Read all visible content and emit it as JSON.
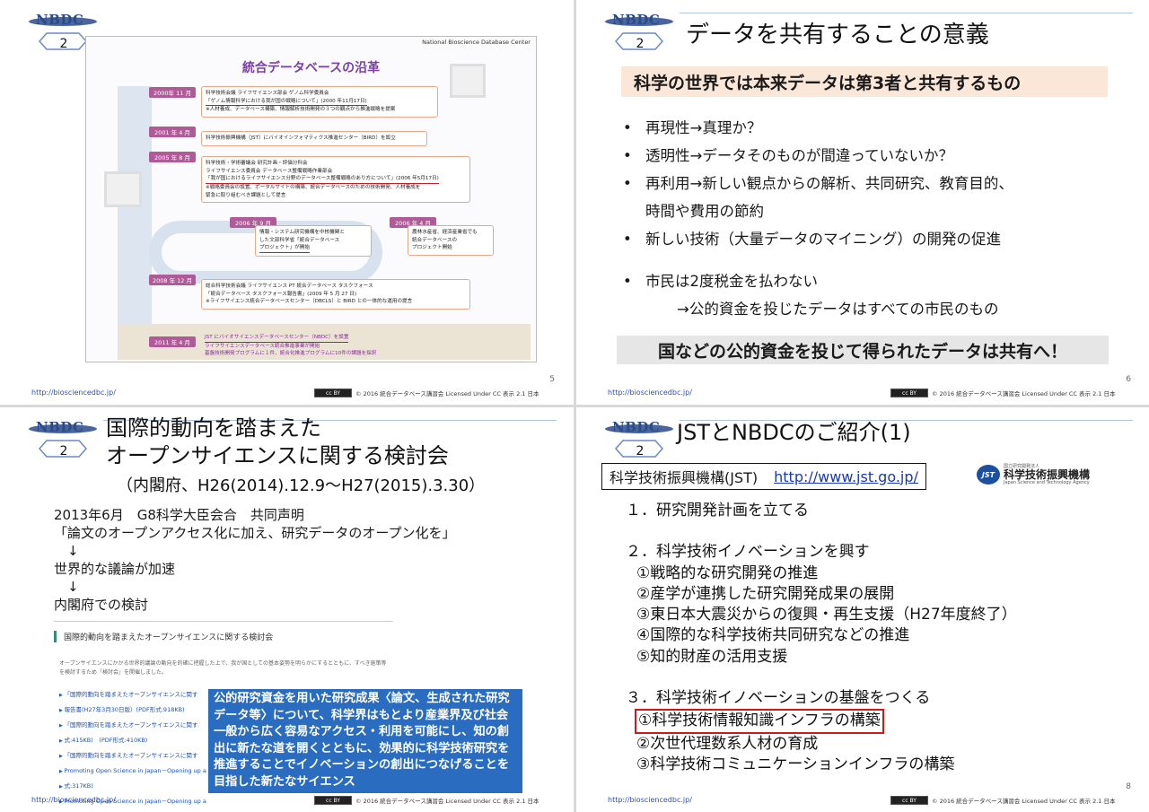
{
  "common": {
    "logo": "NBDC",
    "url": "http://biosciencedbc.jp/",
    "cc_badge": "cc BY",
    "cc_text": "© 2016 統合データベース講習会 Licensed Under CC 表示 2.1 日本"
  },
  "slide1": {
    "logo_num": "2",
    "page": "5",
    "header": "National Bioscience Database Center",
    "title": "統合データベースの沿革",
    "timeline": [
      {
        "date": "2000年 11 月",
        "lines": [
          "科学技術会議 ライフサイエンス部会 ゲノム科学委員会",
          "「ゲノム情報科学における我が国の戦略について」(2000 年11月17日)",
          "※人材養成、データベース構築、情報解析技術開発の３つの観点から推進戦略を提案"
        ]
      },
      {
        "date": "2001 年 4 月",
        "lines": [
          "科学技術振興機構（JST）にバイオインフォマティクス推進センター（BIRD）を設立"
        ]
      },
      {
        "date": "2005 年 8 月",
        "lines": [
          "科学技術・学術審議会 研究計画・評価分科会",
          "ライフサイエンス委員会 データベース整備戦略作業部会",
          "「我が国におけるライフサイエンス分野のデータベース整備戦略のあり方について」(2006 年5月17日)",
          "※戦略委員会の設置、ポータルサイトの構築、統合データベースのための技術開発、人材養成を",
          "緊急に取り組むべき課題として提言"
        ]
      },
      {
        "date": "2006 年 9 月",
        "lines": [
          "情報・システム研究機構を中核機関と",
          "した文部科学省「統合データベース",
          "プロジェクト」が開始"
        ]
      },
      {
        "date": "2006 年 4 月",
        "lines": [
          "農林水産省、経済産業省でも",
          "統合データベースの",
          "プロジェクト開始"
        ]
      },
      {
        "date": "2008 年 12 月",
        "lines": [
          "総合科学技術会議 ライフサイエンス PT 統合データベース タスクフォース",
          "「統合データベース タスクフォース報告書」(2009 年 5 月 27 日)",
          "※ライフサイエンス統合データベースセンター（DBCLS）と BIRD との一体的な運用の提言"
        ]
      },
      {
        "date": "2011 年 4 月",
        "lines": [
          "JST にバイオサイエンスデータベースセンター（NBDC）を設置",
          "ライフサイエンスデータベース統合推進事業が開始",
          "基盤技術開発プログラムに１件、統合化推進プログラムに10件の課題を採択"
        ]
      }
    ]
  },
  "slide2": {
    "logo_num": "2",
    "page": "6",
    "title": "データを共有することの意義",
    "highlight": "科学の世界では本来データは第3者と共有するもの",
    "bullets": [
      "再現性→真理か？",
      "透明性→データそのものが間違っていないか？",
      "再利用→新しい観点からの解析、共同研究、教育目的、",
      "新しい技術（大量データのマイニング）の開発の促進",
      "市民は2度税金を払わない"
    ],
    "cont": "時間や費用の節約",
    "indent": "→公的資金を投じたデータはすべての市民のもの",
    "footer": "国などの公的資金を投じて得られたデータは共有へ！"
  },
  "slide3": {
    "logo_num": "2",
    "title_line1": "国際的動向を踏まえた",
    "title_line2": "オープンサイエンスに関する検討会",
    "subtitle": "（内閣府、H26(2014).12.9〜H27(2015).3.30）",
    "body": [
      "2013年6月　G8科学大臣会合　共同声明",
      "「論文のオープンアクセス化に加え、研究データのオープン化を」",
      "　↓",
      "世界的な議論が加速",
      "　↓",
      "内閣府での検討"
    ],
    "web_heading": "国際的動向を踏まえたオープンサイエンスに関する検討会",
    "web_text": "オープンサイエンスにかかる世界的議論の動向を的確に把握した上で、我が国としての基本姿勢を明らかにするとともに、すべき施策等を検討するため「検討会」を開催しました。",
    "web_links": [
      "「国際的動向を踏まえたオープンサイエンスに関す",
      "報告書(H27年3月30日版）(PDF形式:918KB)",
      "「国際的動向を踏まえたオープンサイエンスに関す",
      "式:415KB)　(PDF形式:410KB)",
      "「国際的動向を踏まえたオープンサイエンスに関す",
      "Promoting Open Science in Japan－Opening up a",
      "式:317KB)",
      "Promoting Open Science in Japan－Opening up a"
    ],
    "callout": "公的研究資金を用いた研究成果〈論文、生成された研究データ等〉について、科学界はもとより産業界及び社会一般から広く容易なアクセス・利用を可能にし、知の創出に新たな道を開くとともに、効果的に科学技術研究を推進することでイノベーションの創出につなげることを目指した新たなサイエンス"
  },
  "slide4": {
    "logo_num": "2",
    "page": "8",
    "title": "JSTとNBDCのご紹介(1)",
    "org": "科学技術振興機構(JST)",
    "link": "http://www.jst.go.jp/",
    "jst_logo_mark": "JST",
    "jst_logo_small": "国立研究開発法人",
    "jst_logo_name": "科学技術振興機構",
    "jst_logo_en": "Japan Science and Technology Agency",
    "items": [
      "１．研究開発計画を立てる",
      "２．科学技術イノベーションを興す",
      "①戦略的な研究開発の推進",
      "②産学が連携した研究開発成果の展開",
      "③東日本大震災からの復興・再生支援（H27年度終了）",
      "④国際的な科学技術共同研究などの推進",
      "⑤知的財産の活用支援",
      "３．科学技術イノベーションの基盤をつくる",
      "①科学技術情報知識インフラの構築",
      "②次世代理数系人材の育成",
      "③科学技術コミュニケーションインフラの構築"
    ]
  }
}
